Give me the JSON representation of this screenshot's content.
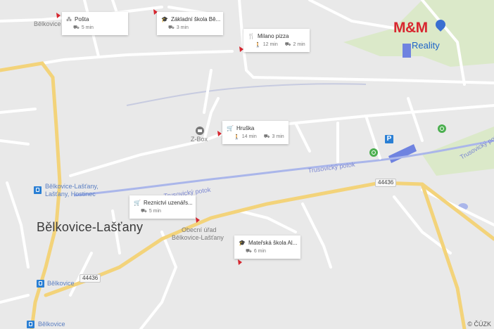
{
  "map": {
    "town_label": "Bělkovice-Lašťany",
    "place_labels": {
      "top_left": "Bělkovice",
      "zbox": "Z-Box",
      "stop_hostinec_1": "Bělkovice-Lašťany,",
      "stop_hostinec_2": "Lašťany, Hostinec",
      "obecni_urad_1": "Obecní úřad",
      "obecni_urad_2": "Bělkovice-Lašťany",
      "stop_belkovice_1": "Bělkovice",
      "stop_belkovice_2": "Bělkovice"
    },
    "water_labels": {
      "trusovicky_1": "Trusovický potok",
      "trusovicky_2": "Trusovický potok",
      "trusovicky_3": "Trusovický potok"
    },
    "road_numbers": [
      "44436",
      "44436"
    ],
    "copyright": "© ČÚZK",
    "colors": {
      "background": "#e9e9e9",
      "road_main": "#f3d37a",
      "road_minor": "#ffffff",
      "water": "#aab6ea",
      "green": "#dbe9c9",
      "accent_pin": "#d6262f"
    }
  },
  "logo": {
    "brand": "M&M",
    "sub": "Reality"
  },
  "pois": [
    {
      "name": "Pošta",
      "icon": "post-icon",
      "walk": "",
      "car": "5 min"
    },
    {
      "name": "Základní škola Bě...",
      "icon": "school-icon",
      "walk": "",
      "car": "3 min"
    },
    {
      "name": "Milano pizza",
      "icon": "restaurant-icon",
      "walk": "12 min",
      "car": "2 min"
    },
    {
      "name": "Hruška",
      "icon": "shop-icon",
      "walk": "14 min",
      "car": "3 min"
    },
    {
      "name": "Reznictvi uzenářs...",
      "icon": "shop-icon",
      "walk": "",
      "car": "5 min"
    },
    {
      "name": "Mateřská škola Al...",
      "icon": "school-icon",
      "walk": "",
      "car": "6 min"
    }
  ]
}
